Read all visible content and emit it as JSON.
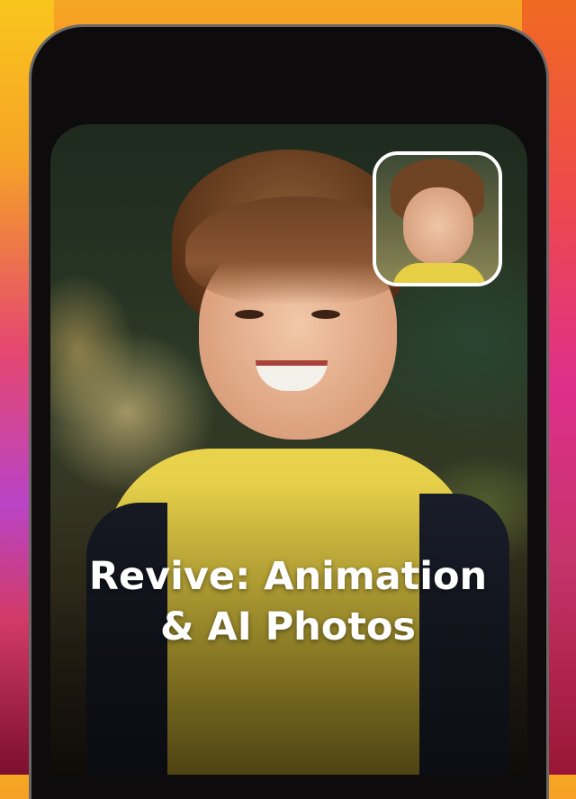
{
  "promo": {
    "title_line1": "Revive: Animation",
    "title_line2": "& AI Photos"
  },
  "colors": {
    "background_top": "#f6a623",
    "background_bottom": "#b21f4a",
    "phone_frame": "#0d0b0c",
    "thumbnail_border": "#ffffff",
    "title_text": "#ffffff"
  }
}
